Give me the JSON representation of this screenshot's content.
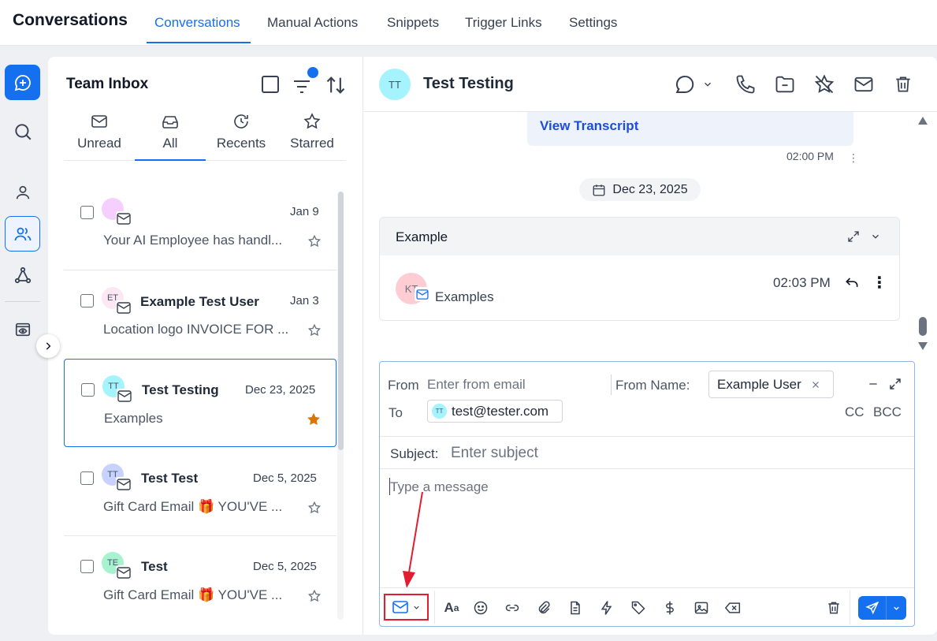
{
  "top": {
    "app_title": "Conversations",
    "tabs": [
      "Conversations",
      "Manual Actions",
      "Snippets",
      "Trigger Links",
      "Settings"
    ]
  },
  "inbox": {
    "title": "Team Inbox",
    "filters": [
      "Unread",
      "All",
      "Recents",
      "Starred"
    ],
    "rows": [
      {
        "initials": "",
        "name": "",
        "date": "Jan 9",
        "preview": "Your AI Employee has handl...",
        "starred": false
      },
      {
        "initials": "ET",
        "name": "Example Test User",
        "date": "Jan 3",
        "preview": "Location logo INVOICE FOR ...",
        "starred": false
      },
      {
        "initials": "TT",
        "name": "Test Testing",
        "date": "Dec 23, 2025",
        "preview": "Examples",
        "starred": true
      },
      {
        "initials": "TT",
        "name": "Test Test",
        "date": "Dec 5, 2025",
        "preview": "Gift Card Email 🎁 YOU'VE ...",
        "starred": false
      },
      {
        "initials": "TE",
        "name": "Test",
        "date": "Dec 5, 2025",
        "preview": "Gift Card Email 🎁 YOU'VE ...",
        "starred": false
      }
    ]
  },
  "conversation": {
    "contact_initials": "TT",
    "contact_name": "Test Testing",
    "transcript_link": "View Transcript",
    "message_time": "02:00 PM",
    "date_separator": "Dec 23, 2025",
    "email_card": {
      "title": "Example",
      "sender_initials": "KT",
      "snippet": "Examples",
      "time": "02:03 PM"
    }
  },
  "composer": {
    "from_label": "From",
    "from_placeholder": "Enter from email",
    "from_name_label": "From Name:",
    "from_name_value": "Example User",
    "to_label": "To",
    "to_initials": "TT",
    "to_value": "test@tester.com",
    "cc_label": "CC",
    "bcc_label": "BCC",
    "subject_label": "Subject:",
    "subject_placeholder": "Enter subject",
    "message_placeholder": "Type a message"
  },
  "colors": {
    "accent": "#1570ef",
    "highlight_box": "#e11d2f",
    "star_filled": "#d97706"
  }
}
